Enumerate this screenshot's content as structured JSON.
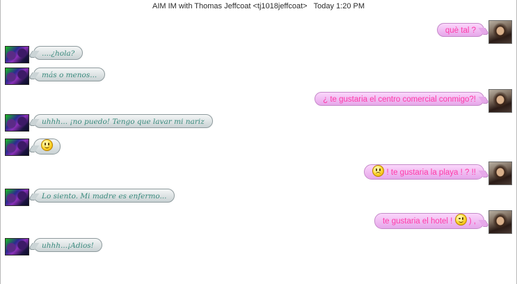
{
  "header": {
    "title": "AIM IM with Thomas Jeffcoat <tj1018jeffcoat>",
    "time": "Today 1:20 PM"
  },
  "messages": [
    {
      "dir": "out",
      "text": "què tal ?"
    },
    {
      "dir": "in",
      "text": "....¿hola?"
    },
    {
      "dir": "in",
      "text": "más o menos..."
    },
    {
      "dir": "out",
      "text": "¿ te gustaria el centro comercial conmigo?!"
    },
    {
      "dir": "in",
      "text": "uhhh... ¡no puedo! Tengo que lavar mi nariz"
    },
    {
      "dir": "in",
      "emoji": "smile-icon"
    },
    {
      "dir": "out",
      "emoji": "frown-icon",
      "text": "! te gustaria la playa ! ? !!"
    },
    {
      "dir": "in",
      "text": "Lo siento. Mi madre es enfermo..."
    },
    {
      "dir": "out",
      "text": "te gustaria el hotel !",
      "emoji": "wink-icon",
      "suffix": ") ,"
    },
    {
      "dir": "in",
      "text": "uhhh...¡Adios!"
    }
  ]
}
